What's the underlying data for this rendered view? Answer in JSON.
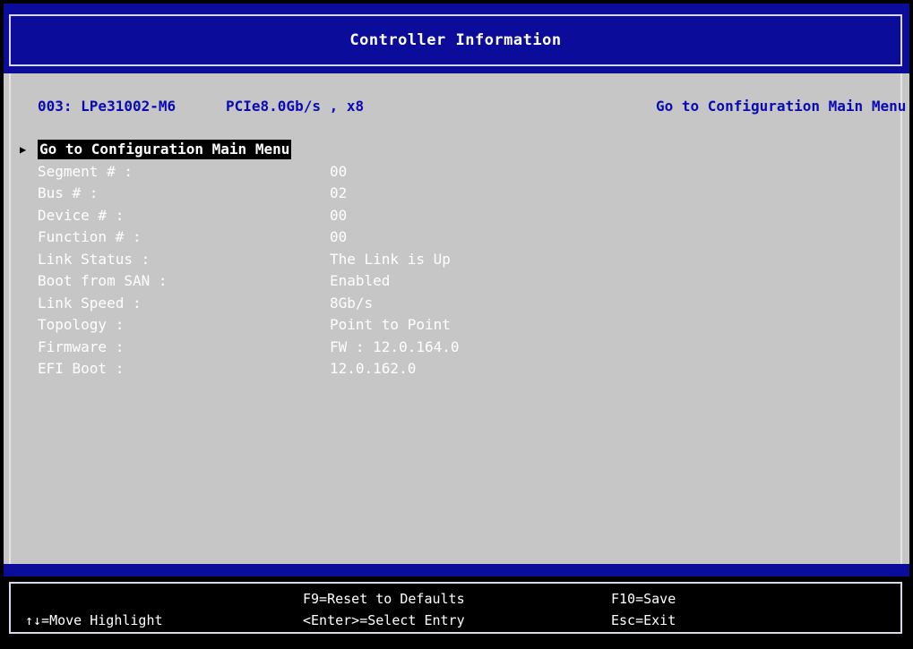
{
  "header": {
    "title": "Controller Information"
  },
  "controller": {
    "model": "003: LPe31002-M6",
    "pcie": "PCIe8.0Gb/s , x8"
  },
  "help_text": "Go to Configuration Main Menu",
  "menu_entry": {
    "label": "Go to Configuration Main Menu",
    "pointer_icon": "triangle-right-icon"
  },
  "fields": [
    {
      "label": "Segment # :",
      "value": "00"
    },
    {
      "label": "Bus # :",
      "value": "02"
    },
    {
      "label": "Device # :",
      "value": "00"
    },
    {
      "label": "Function # :",
      "value": "00"
    },
    {
      "label": "Link Status :",
      "value": "The Link is Up"
    },
    {
      "label": "Boot from SAN :",
      "value": "Enabled"
    },
    {
      "label": "Link Speed :",
      "value": "8Gb/s"
    },
    {
      "label": "Topology :",
      "value": "Point to Point"
    },
    {
      "label": "Firmware :",
      "value": "FW : 12.0.164.0"
    },
    {
      "label": "EFI Boot :",
      "value": "12.0.162.0"
    }
  ],
  "footer": {
    "move": "↑↓=Move Highlight",
    "reset": "F9=Reset to Defaults",
    "select": "<Enter>=Select Entry",
    "save": "F10=Save",
    "exit": "Esc=Exit"
  },
  "colors": {
    "header_bg": "#0c0c9a",
    "main_bg": "#c6c6c6",
    "info_text": "#0a0ab4",
    "footer_bg": "#000000"
  }
}
